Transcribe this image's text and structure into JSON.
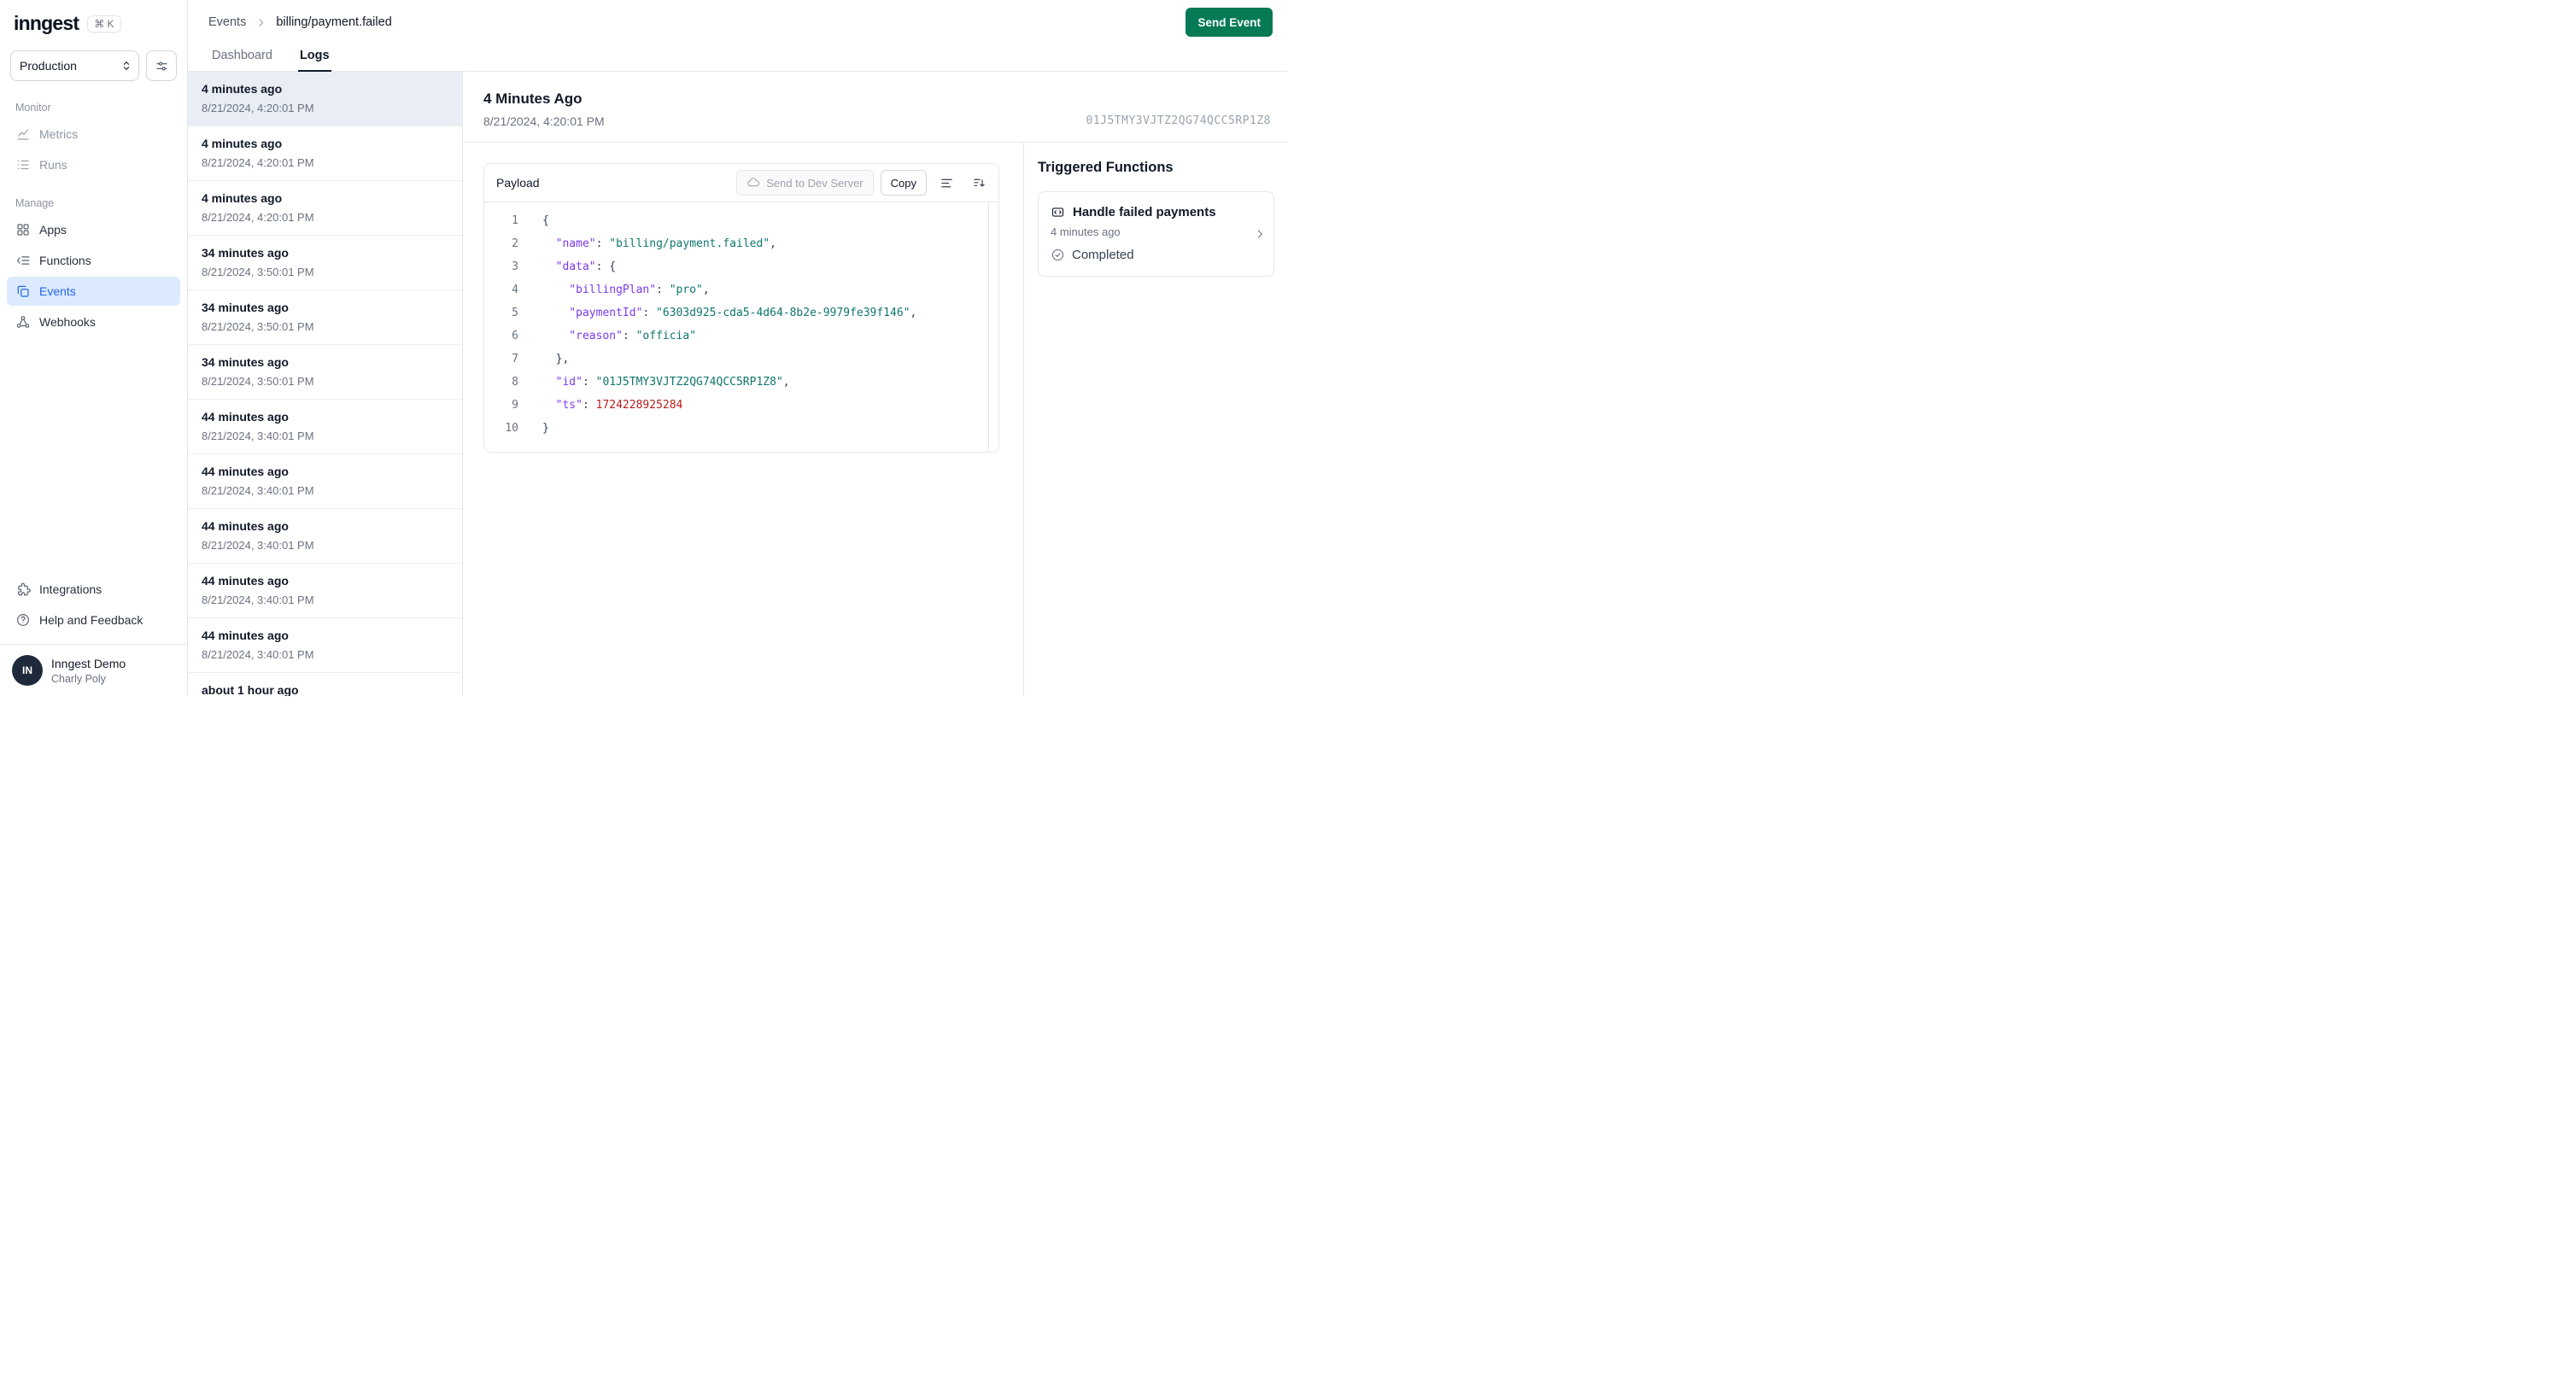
{
  "colors": {
    "accent_green": "#057a55",
    "active_blue": "#2563eb",
    "active_blue_bg": "#dbeafe",
    "selected_row_bg": "#e9eef5",
    "code_key": "#7c3aed",
    "code_string": "#0f766e",
    "code_number": "#b91c1c",
    "code_punctuation": "#334155"
  },
  "app": {
    "logo_text": "inngest",
    "command_shortcut": "⌘ K"
  },
  "sidebar": {
    "environment": {
      "value": "Production"
    },
    "sections": [
      {
        "label": "Monitor",
        "items": [
          {
            "label": "Metrics",
            "icon": "metrics-chart-icon"
          },
          {
            "label": "Runs",
            "icon": "runs-list-icon"
          }
        ]
      },
      {
        "label": "Manage",
        "items": [
          {
            "label": "Apps",
            "icon": "apps-grid-icon"
          },
          {
            "label": "Functions",
            "icon": "functions-list-icon"
          },
          {
            "label": "Events",
            "icon": "events-copy-icon",
            "active": true
          },
          {
            "label": "Webhooks",
            "icon": "webhooks-icon"
          }
        ]
      }
    ],
    "footer_items": [
      {
        "label": "Integrations",
        "icon": "puzzle-icon"
      },
      {
        "label": "Help and Feedback",
        "icon": "help-circle-icon"
      }
    ],
    "user": {
      "initials": "IN",
      "name": "Inngest Demo",
      "subtitle": "Charly Poly"
    }
  },
  "header": {
    "breadcrumb": [
      "Events",
      "billing/payment.failed"
    ],
    "send_event_label": "Send Event",
    "tabs": [
      {
        "label": "Dashboard",
        "active": false
      },
      {
        "label": "Logs",
        "active": true
      }
    ]
  },
  "event_list": {
    "items": [
      {
        "relative": "4 minutes ago",
        "timestamp": "8/21/2024, 4:20:01 PM",
        "selected": true
      },
      {
        "relative": "4 minutes ago",
        "timestamp": "8/21/2024, 4:20:01 PM"
      },
      {
        "relative": "4 minutes ago",
        "timestamp": "8/21/2024, 4:20:01 PM"
      },
      {
        "relative": "34 minutes ago",
        "timestamp": "8/21/2024, 3:50:01 PM"
      },
      {
        "relative": "34 minutes ago",
        "timestamp": "8/21/2024, 3:50:01 PM"
      },
      {
        "relative": "34 minutes ago",
        "timestamp": "8/21/2024, 3:50:01 PM"
      },
      {
        "relative": "44 minutes ago",
        "timestamp": "8/21/2024, 3:40:01 PM"
      },
      {
        "relative": "44 minutes ago",
        "timestamp": "8/21/2024, 3:40:01 PM"
      },
      {
        "relative": "44 minutes ago",
        "timestamp": "8/21/2024, 3:40:01 PM"
      },
      {
        "relative": "44 minutes ago",
        "timestamp": "8/21/2024, 3:40:01 PM"
      },
      {
        "relative": "44 minutes ago",
        "timestamp": "8/21/2024, 3:40:01 PM"
      },
      {
        "relative": "about 1 hour ago",
        "timestamp": ""
      }
    ]
  },
  "detail": {
    "title": "4 Minutes Ago",
    "timestamp": "8/21/2024, 4:20:01 PM",
    "event_id": "01J5TMY3VJTZ2QG74QCC5RP1Z8",
    "payload": {
      "title": "Payload",
      "send_to_dev_server_label": "Send to Dev Server",
      "copy_label": "Copy",
      "lines": [
        {
          "n": 1,
          "tokens": [
            [
              "p",
              "{"
            ]
          ]
        },
        {
          "n": 2,
          "tokens": [
            [
              "p",
              "  "
            ],
            [
              "k",
              "\"name\""
            ],
            [
              "p",
              ": "
            ],
            [
              "s",
              "\"billing/payment.failed\""
            ],
            [
              "p",
              ","
            ]
          ]
        },
        {
          "n": 3,
          "tokens": [
            [
              "p",
              "  "
            ],
            [
              "k",
              "\"data\""
            ],
            [
              "p",
              ": {"
            ]
          ]
        },
        {
          "n": 4,
          "tokens": [
            [
              "p",
              "    "
            ],
            [
              "k",
              "\"billingPlan\""
            ],
            [
              "p",
              ": "
            ],
            [
              "s",
              "\"pro\""
            ],
            [
              "p",
              ","
            ]
          ]
        },
        {
          "n": 5,
          "tokens": [
            [
              "p",
              "    "
            ],
            [
              "k",
              "\"paymentId\""
            ],
            [
              "p",
              ": "
            ],
            [
              "s",
              "\"6303d925-cda5-4d64-8b2e-9979fe39f146\""
            ],
            [
              "p",
              ","
            ]
          ]
        },
        {
          "n": 6,
          "tokens": [
            [
              "p",
              "    "
            ],
            [
              "k",
              "\"reason\""
            ],
            [
              "p",
              ": "
            ],
            [
              "s",
              "\"officia\""
            ]
          ]
        },
        {
          "n": 7,
          "tokens": [
            [
              "p",
              "  },"
            ]
          ]
        },
        {
          "n": 8,
          "tokens": [
            [
              "p",
              "  "
            ],
            [
              "k",
              "\"id\""
            ],
            [
              "p",
              ": "
            ],
            [
              "s",
              "\"01J5TMY3VJTZ2QG74QCC5RP1Z8\""
            ],
            [
              "p",
              ","
            ]
          ]
        },
        {
          "n": 9,
          "tokens": [
            [
              "p",
              "  "
            ],
            [
              "k",
              "\"ts\""
            ],
            [
              "p",
              ": "
            ],
            [
              "n",
              "1724228925284"
            ]
          ]
        },
        {
          "n": 10,
          "tokens": [
            [
              "p",
              "}"
            ]
          ]
        }
      ]
    },
    "triggered_functions": {
      "title": "Triggered Functions",
      "cards": [
        {
          "name": "Handle failed payments",
          "relative": "4 minutes ago",
          "status": "Completed"
        }
      ]
    }
  }
}
